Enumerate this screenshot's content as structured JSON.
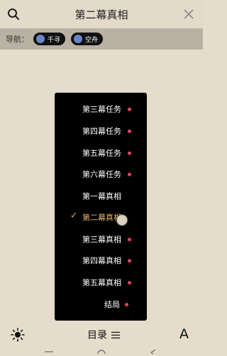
{
  "header": {
    "title": "第二幕真相"
  },
  "nav": {
    "label": "导航：",
    "items": [
      {
        "label": "千寻"
      },
      {
        "label": "空舟"
      }
    ]
  },
  "menu": {
    "items": [
      {
        "label": "第三幕任务",
        "dot": true,
        "active": false
      },
      {
        "label": "第四幕任务",
        "dot": true,
        "active": false
      },
      {
        "label": "第五幕任务",
        "dot": true,
        "active": false
      },
      {
        "label": "第六幕任务",
        "dot": true,
        "active": false
      },
      {
        "label": "第一幕真相",
        "dot": false,
        "active": false
      },
      {
        "label": "第二幕真相",
        "dot": false,
        "active": true
      },
      {
        "label": "第三幕真相",
        "dot": true,
        "active": false
      },
      {
        "label": "第四幕真相",
        "dot": true,
        "active": false
      },
      {
        "label": "第五幕真相",
        "dot": true,
        "active": false
      },
      {
        "label": "结局",
        "dot": true,
        "active": false
      }
    ],
    "check_glyph": "✓"
  },
  "footer": {
    "toc_label": "目录",
    "font_label": "A"
  },
  "colors": {
    "accent": "#e8b36a",
    "dot": "#e0455a",
    "background": "#e6dccb",
    "menu_bg": "#000000"
  }
}
